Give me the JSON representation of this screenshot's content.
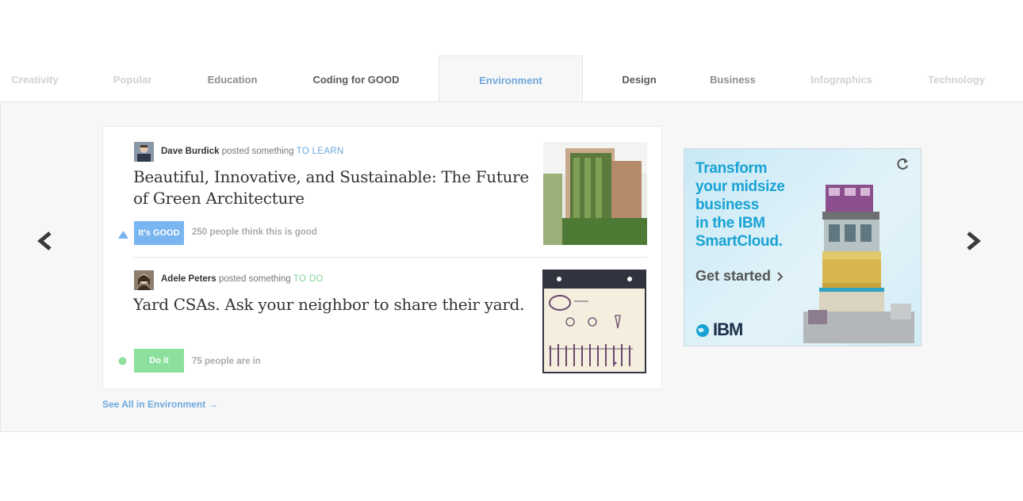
{
  "tabs": [
    {
      "label": "Creativity"
    },
    {
      "label": "Popular"
    },
    {
      "label": "Education"
    },
    {
      "label": "Coding for GOOD"
    },
    {
      "label": "Environment"
    },
    {
      "label": "Design"
    },
    {
      "label": "Business"
    },
    {
      "label": "Infographics"
    },
    {
      "label": "Technology"
    }
  ],
  "carousel": {
    "prev_icon": "‹",
    "next_icon": "›"
  },
  "posts": [
    {
      "author": "Dave Burdick",
      "action": "posted something",
      "tag": "TO LEARN",
      "title": "Beautiful, Innovative, and Sustainable: The Future of Green Architecture",
      "button": "It's GOOD",
      "count_text": "250 people think this is good",
      "button_color": "#79b5f0",
      "indicator": "triangle-up-icon"
    },
    {
      "author": "Adele Peters",
      "action": "posted something",
      "tag": "TO DO",
      "title": "Yard CSAs. Ask your neighbor to share their yard.",
      "button": "Do it",
      "count_text": "75 people are in",
      "button_color": "#8ddf9e",
      "indicator": "green-dot-icon"
    }
  ],
  "see_all": "See All in Environment →",
  "ad": {
    "lines": [
      "Transform",
      "your midsize",
      "business",
      "in the IBM",
      "SmartCloud."
    ],
    "cta": "Get started",
    "brand": "IBM"
  }
}
